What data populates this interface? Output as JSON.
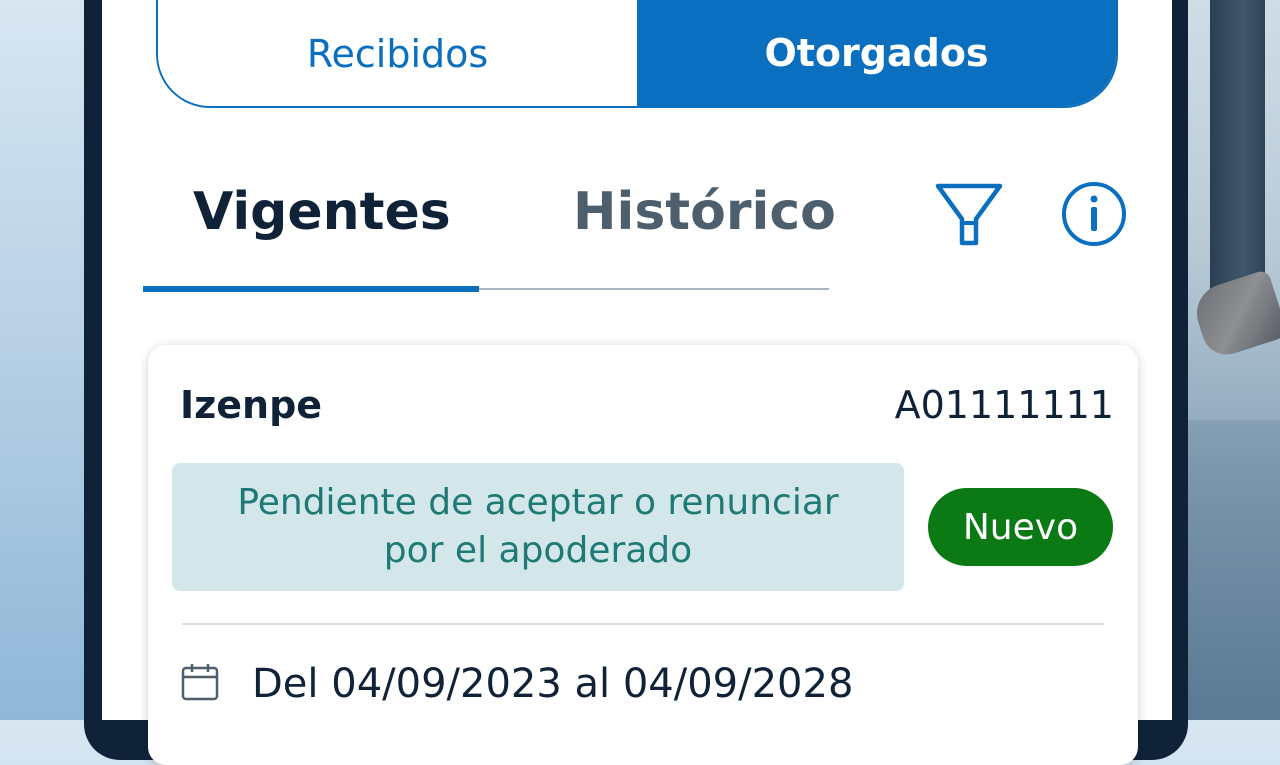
{
  "segmented": {
    "left_label": "Recibidos",
    "right_label": "Otorgados",
    "selected": "Otorgados"
  },
  "tabs": {
    "active_label": "Vigentes",
    "inactive_label": "Histórico"
  },
  "toolbar": {
    "filter_icon": "filter-icon",
    "info_icon": "info-icon"
  },
  "card": {
    "name": "Izenpe",
    "id": "A01111111",
    "status_line1": "Pendiente de aceptar o renunciar",
    "status_line2": "por el apoderado",
    "badge": "Nuevo",
    "dates": "Del 04/09/2023 al 04/09/2028",
    "calendar_icon": "calendar-icon"
  },
  "colors": {
    "primary": "#0b6fc0",
    "dark": "#0f2238",
    "badge_green": "#0b7a14",
    "status_bg": "#d3e6ea",
    "status_text": "#1f7a76"
  }
}
